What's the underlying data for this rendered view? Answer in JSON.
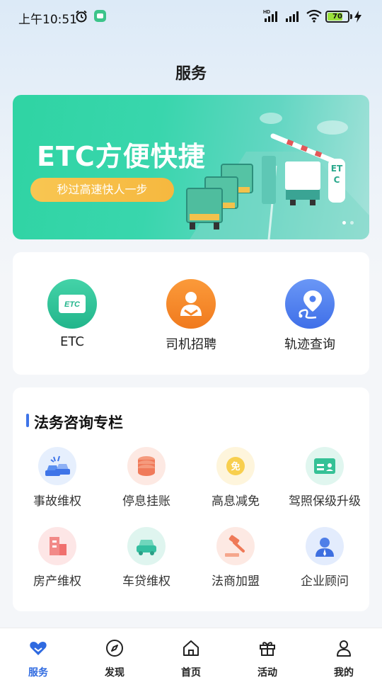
{
  "status_bar": {
    "time": "上午10:51",
    "battery": "70",
    "network_label": "HD"
  },
  "header": {
    "title": "服务"
  },
  "banner": {
    "title": "ETC方便快捷",
    "subtitle": "秒过高速快人一步",
    "sign_text": "ETC",
    "slide_count": 2,
    "active_slide": 1
  },
  "quick_services": [
    {
      "label": "ETC",
      "icon": "etc-card-icon",
      "icon_text": "ETC",
      "color": "#2fc59a"
    },
    {
      "label": "司机招聘",
      "icon": "driver-icon",
      "color": "#f5872a"
    },
    {
      "label": "轨迹查询",
      "icon": "location-track-icon",
      "color": "#4f7ff0"
    }
  ],
  "legal": {
    "title": "法务咨询专栏",
    "items": [
      {
        "label": "事故维权",
        "icon": "car-accident-icon",
        "bg": "#e6effd",
        "fg": "#3e74e8"
      },
      {
        "label": "停息挂账",
        "icon": "coin-stack-icon",
        "bg": "#fde9e3",
        "fg": "#f07a5a"
      },
      {
        "label": "高息减免",
        "icon": "discount-coin-icon",
        "bg": "#fef5dc",
        "fg": "#f5c33c",
        "icon_text": "免"
      },
      {
        "label": "驾照保级升级",
        "icon": "license-card-icon",
        "bg": "#e0f6ef",
        "fg": "#35c196"
      },
      {
        "label": "房产维权",
        "icon": "building-icon",
        "bg": "#fde6e6",
        "fg": "#f0706e"
      },
      {
        "label": "车贷维权",
        "icon": "car-icon",
        "bg": "#dff5ef",
        "fg": "#34bfa0"
      },
      {
        "label": "法商加盟",
        "icon": "gavel-icon",
        "bg": "#fde9e3",
        "fg": "#ef7a58"
      },
      {
        "label": "企业顾问",
        "icon": "consultant-icon",
        "bg": "#e3ecfd",
        "fg": "#3e6fe0"
      }
    ]
  },
  "tabbar": [
    {
      "label": "服务",
      "icon": "heart-icon",
      "active": true
    },
    {
      "label": "发现",
      "icon": "compass-icon",
      "active": false
    },
    {
      "label": "首页",
      "icon": "home-icon",
      "active": false
    },
    {
      "label": "活动",
      "icon": "gift-icon",
      "active": false
    },
    {
      "label": "我的",
      "icon": "user-icon",
      "active": false
    }
  ],
  "colors": {
    "accent": "#2f6ae0",
    "banner_green": "#2fd4a3",
    "pill_yellow": "#f8c652"
  }
}
